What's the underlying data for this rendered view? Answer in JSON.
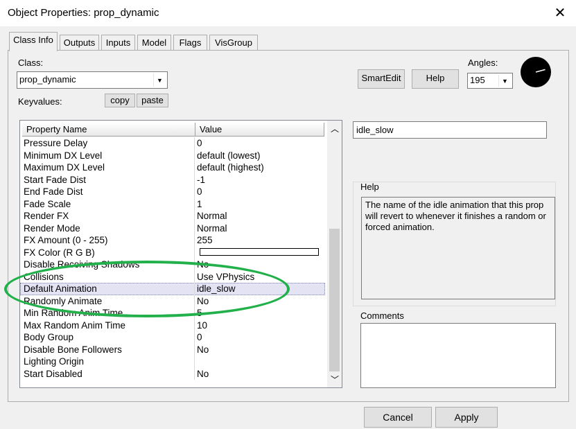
{
  "window": {
    "title": "Object Properties: prop_dynamic"
  },
  "tabs": [
    {
      "label": "Class Info",
      "active": true
    },
    {
      "label": "Outputs"
    },
    {
      "label": "Inputs"
    },
    {
      "label": "Model"
    },
    {
      "label": "Flags"
    },
    {
      "label": "VisGroup"
    }
  ],
  "class_info": {
    "class_label": "Class:",
    "class_value": "prop_dynamic",
    "keyvalues_label": "Keyvalues:",
    "copy_label": "copy",
    "paste_label": "paste",
    "smartedit_label": "SmartEdit",
    "help_label": "Help",
    "angles_label": "Angles:",
    "angles_value": "195",
    "dial_angle_degrees": 195
  },
  "properties": {
    "header_name": "Property Name",
    "header_value": "Value",
    "rows": [
      {
        "name": "Pressure Delay",
        "value": "0"
      },
      {
        "name": "Minimum DX Level",
        "value": "default (lowest)"
      },
      {
        "name": "Maximum DX Level",
        "value": "default (highest)"
      },
      {
        "name": "Start Fade Dist",
        "value": "-1"
      },
      {
        "name": "End Fade Dist",
        "value": "0"
      },
      {
        "name": "Fade Scale",
        "value": "1"
      },
      {
        "name": "Render FX",
        "value": "Normal"
      },
      {
        "name": "Render Mode",
        "value": "Normal"
      },
      {
        "name": "FX Amount (0 - 255)",
        "value": "255"
      },
      {
        "name": "FX Color (R G B)",
        "value": "",
        "color": "#ffffff"
      },
      {
        "name": "Disable Receiving Shadows",
        "value": "No"
      },
      {
        "name": "Collisions",
        "value": "Use VPhysics"
      },
      {
        "name": "Default Animation",
        "value": "idle_slow",
        "selected": true
      },
      {
        "name": "Randomly Animate",
        "value": "No"
      },
      {
        "name": "Min Random Anim Time",
        "value": "5"
      },
      {
        "name": "Max Random Anim Time",
        "value": "10"
      },
      {
        "name": "Body Group",
        "value": "0"
      },
      {
        "name": "Disable Bone Followers",
        "value": "No"
      },
      {
        "name": "Lighting Origin",
        "value": ""
      },
      {
        "name": "Start Disabled",
        "value": "No"
      }
    ]
  },
  "value_edit": {
    "value": "idle_slow"
  },
  "help_panel": {
    "label": "Help",
    "text": "The name of the idle animation that this prop will revert to whenever it finishes a random or forced animation."
  },
  "comments": {
    "label": "Comments",
    "value": ""
  },
  "footer": {
    "cancel_label": "Cancel",
    "apply_label": "Apply"
  },
  "colors": {
    "highlight_ellipse": "#22b04a",
    "default_button_border": "#0078d7"
  }
}
